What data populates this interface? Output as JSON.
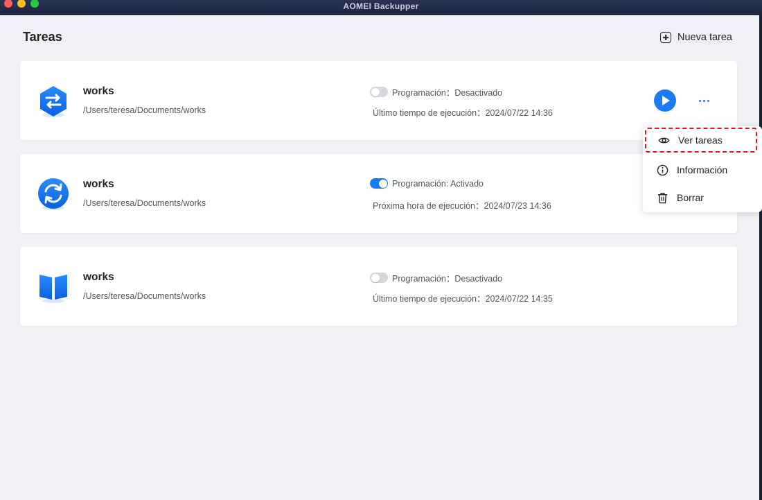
{
  "window": {
    "title": "AOMEI Backupper"
  },
  "header": {
    "title": "Tareas",
    "new_task_label": "Nueva tarea"
  },
  "tasks": [
    {
      "name": "works",
      "path": "/Users/teresa/Documents/works",
      "icon": "sync-hexagon-icon",
      "schedule_enabled": false,
      "schedule_label": "Programación：Desactivado",
      "runtime_label": "Último tiempo de ejecución：2024/07/22 14:36"
    },
    {
      "name": "works",
      "path": "/Users/teresa/Documents/works",
      "icon": "backup-circle-icon",
      "schedule_enabled": true,
      "schedule_label": "Programación: Activado",
      "runtime_label": "Próxima hora de ejecución：2024/07/23 14:36"
    },
    {
      "name": "works",
      "path": "/Users/teresa/Documents/works",
      "icon": "mirror-book-icon",
      "schedule_enabled": false,
      "schedule_label": "Programación：Desactivado",
      "runtime_label": "Último tiempo de ejecución：2024/07/22 14:35"
    }
  ],
  "context_menu": {
    "items": [
      {
        "label": "Ver tareas",
        "icon": "eye-icon"
      },
      {
        "label": "Información",
        "icon": "info-icon"
      },
      {
        "label": "Borrar",
        "icon": "trash-icon"
      }
    ]
  },
  "colors": {
    "accent": "#1a7cf5",
    "highlight": "#e0141e",
    "background": "#f0f1f5"
  }
}
